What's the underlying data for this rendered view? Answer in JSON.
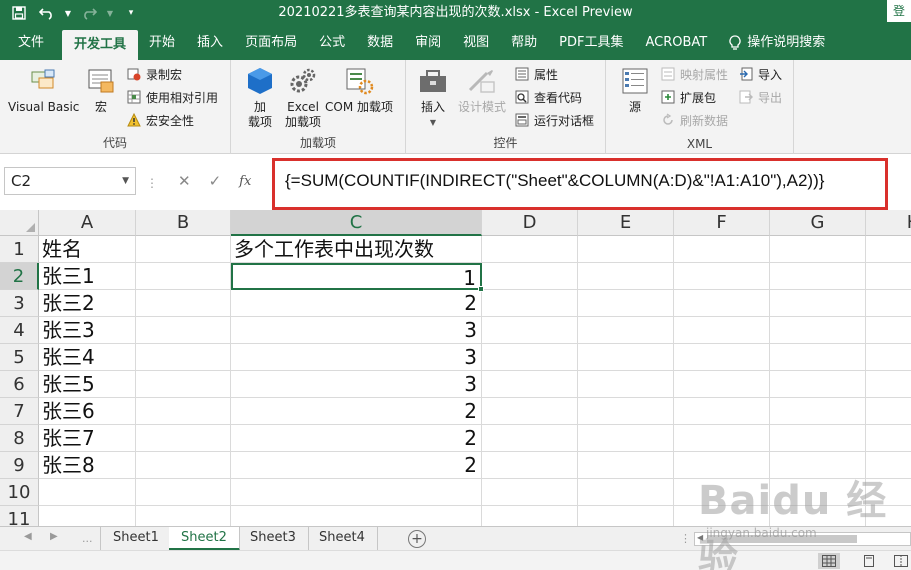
{
  "window": {
    "title": "20210221多表查询某内容出现的次数.xlsx  -  Excel Preview",
    "login_label": "登"
  },
  "quick_access": [
    {
      "icon": "save-icon"
    },
    {
      "icon": "undo-icon"
    },
    {
      "icon": "redo-icon"
    },
    {
      "icon": "customize-toolbar-icon"
    }
  ],
  "ribbon_tabs": [
    {
      "name": "file",
      "label": "文件"
    },
    {
      "name": "developer",
      "label": "开发工具",
      "active": true
    },
    {
      "name": "home",
      "label": "开始"
    },
    {
      "name": "insert",
      "label": "插入"
    },
    {
      "name": "page-layout",
      "label": "页面布局"
    },
    {
      "name": "formulas",
      "label": "公式"
    },
    {
      "name": "data",
      "label": "数据"
    },
    {
      "name": "review",
      "label": "审阅"
    },
    {
      "name": "view",
      "label": "视图"
    },
    {
      "name": "help",
      "label": "帮助"
    },
    {
      "name": "pdf-tools",
      "label": "PDF工具集"
    },
    {
      "name": "acrobat",
      "label": "ACROBAT"
    }
  ],
  "tell_me": {
    "label": "操作说明搜索",
    "icon": "lightbulb-icon"
  },
  "ribbon": {
    "code": {
      "label": "代码",
      "visual_basic": "Visual Basic",
      "macros": "宏",
      "record_macro": "录制宏",
      "relative_refs": "使用相对引用",
      "macro_security": "宏安全性"
    },
    "addins": {
      "label": "加载项",
      "addins_line1": "加",
      "addins_line2": "载项",
      "excel_addins_line1": "Excel",
      "excel_addins_line2": "加载项",
      "com_addins": "COM 加载项"
    },
    "controls": {
      "label": "控件",
      "insert": "插入",
      "design_mode": "设计模式",
      "properties": "属性",
      "view_code": "查看代码",
      "run_dialog": "运行对话框"
    },
    "xml": {
      "label": "XML",
      "source": "源",
      "map_properties": "映射属性",
      "expansion_packs": "扩展包",
      "refresh_data": "刷新数据",
      "import": "导入",
      "export": "导出"
    }
  },
  "formula_bar": {
    "name_box": "C2",
    "fx": "fx",
    "formula": "{=SUM(COUNTIF(INDIRECT(\"Sheet\"&COLUMN(A:D)&\"!A1:A10\"),A2))}"
  },
  "columns": [
    "A",
    "B",
    "C",
    "D",
    "E",
    "F",
    "G",
    "H"
  ],
  "rows": [
    "1",
    "2",
    "3",
    "4",
    "5",
    "6",
    "7",
    "8",
    "9",
    "10",
    "11"
  ],
  "cells": {
    "header_a": "姓名",
    "header_c": "多个工作表中出现次数",
    "names": [
      "张三1",
      "张三2",
      "张三3",
      "张三4",
      "张三5",
      "张三6",
      "张三7",
      "张三8"
    ],
    "counts": [
      "1",
      "2",
      "3",
      "3",
      "3",
      "2",
      "2",
      "2"
    ]
  },
  "sheets": [
    {
      "label": "Sheet1"
    },
    {
      "label": "Sheet2",
      "active": true
    },
    {
      "label": "Sheet3"
    },
    {
      "label": "Sheet4"
    }
  ],
  "sheet_ellipsis": "...",
  "watermark": {
    "main": "Baidu 经验",
    "sub": "jingyan.baidu.com"
  },
  "colors": {
    "excel_green": "#217346",
    "highlight_red": "#d9302c"
  }
}
